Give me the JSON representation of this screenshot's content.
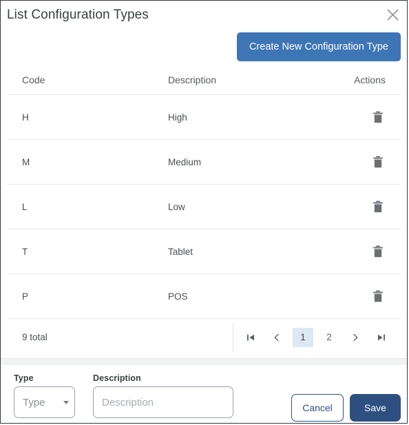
{
  "dialog": {
    "title": "List Configuration Types",
    "close_icon": "close-icon"
  },
  "toolbar": {
    "create_label": "Create New Configuration Type"
  },
  "table": {
    "columns": [
      "Code",
      "Description",
      "Actions"
    ],
    "rows": [
      {
        "code": "H",
        "description": "High",
        "action_icon": "trash-icon"
      },
      {
        "code": "M",
        "description": "Medium",
        "action_icon": "trash-icon"
      },
      {
        "code": "L",
        "description": "Low",
        "action_icon": "trash-icon"
      },
      {
        "code": "T",
        "description": "Tablet",
        "action_icon": "trash-icon"
      },
      {
        "code": "P",
        "description": "POS",
        "action_icon": "trash-icon"
      }
    ]
  },
  "pagination": {
    "total_label": "9 total",
    "first_icon": "first-page-icon",
    "prev_icon": "chevron-left-icon",
    "pages": [
      "1",
      "2"
    ],
    "active_page": "1",
    "next_icon": "chevron-right-icon",
    "last_icon": "last-page-icon"
  },
  "form": {
    "type_label": "Type",
    "type_value": "Type",
    "type_caret_icon": "chevron-down-icon",
    "description_label": "Description",
    "description_value": "",
    "description_placeholder": "Description",
    "cancel_label": "Cancel",
    "save_label": "Save"
  },
  "colors": {
    "primary_blue": "#3e76b5",
    "navy": "#2d5081",
    "active_page_bg": "#dce9f5",
    "row_divider": "#e7e8e9",
    "icon_gray": "#6b6f73"
  }
}
